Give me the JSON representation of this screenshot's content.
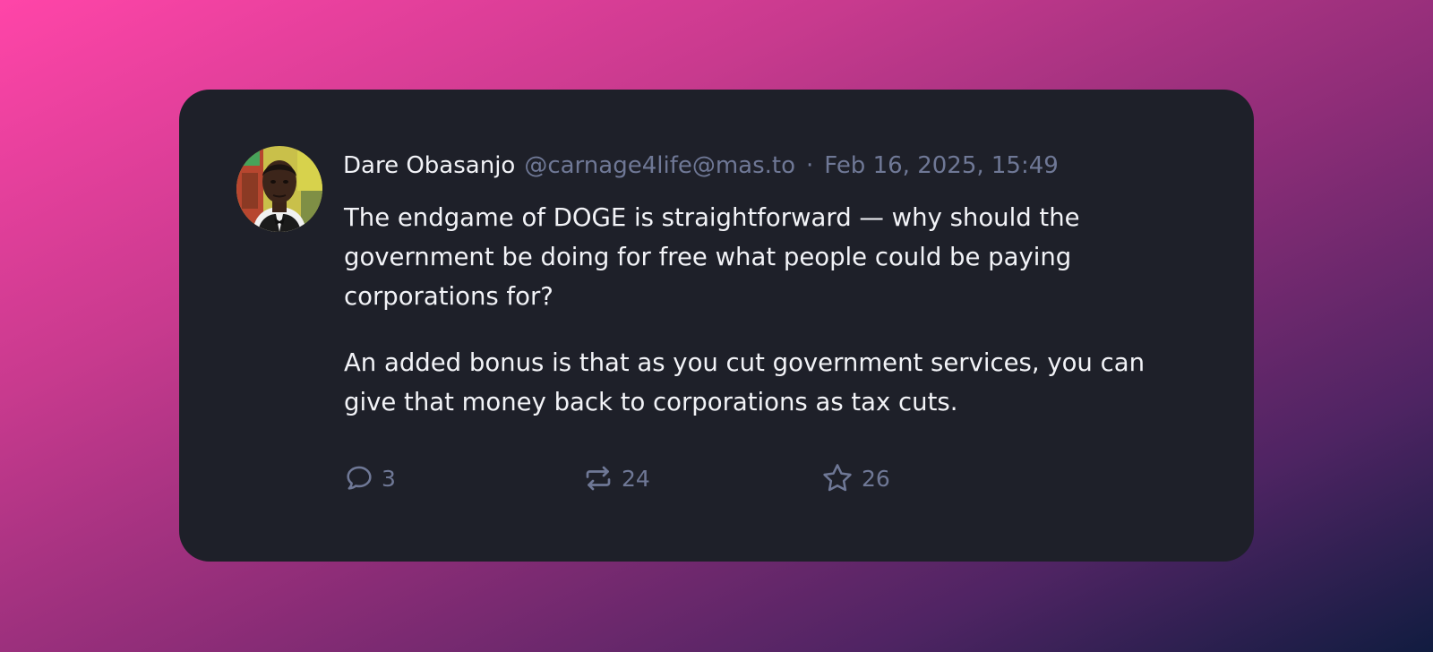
{
  "post": {
    "author": {
      "display_name": "Dare Obasanjo",
      "handle": "@carnage4life@mas.to"
    },
    "separator": "·",
    "timestamp": "Feb 16, 2025, 15:49",
    "paragraphs": [
      "The endgame of DOGE is straightforward — why should the government be doing for free what people could be paying corporations for?",
      "An added bonus is that as you cut government services, you can give that money back to corporations as tax cuts."
    ],
    "stats": {
      "replies": "3",
      "boosts": "24",
      "favourites": "26"
    }
  },
  "icons": {
    "reply": "speech-bubble-icon",
    "boost": "repost-arrows-icon",
    "favourite": "star-icon"
  },
  "colors": {
    "card_background": "#1e2029",
    "primary_text": "#f2f3f7",
    "muted_text": "#6f7896"
  }
}
